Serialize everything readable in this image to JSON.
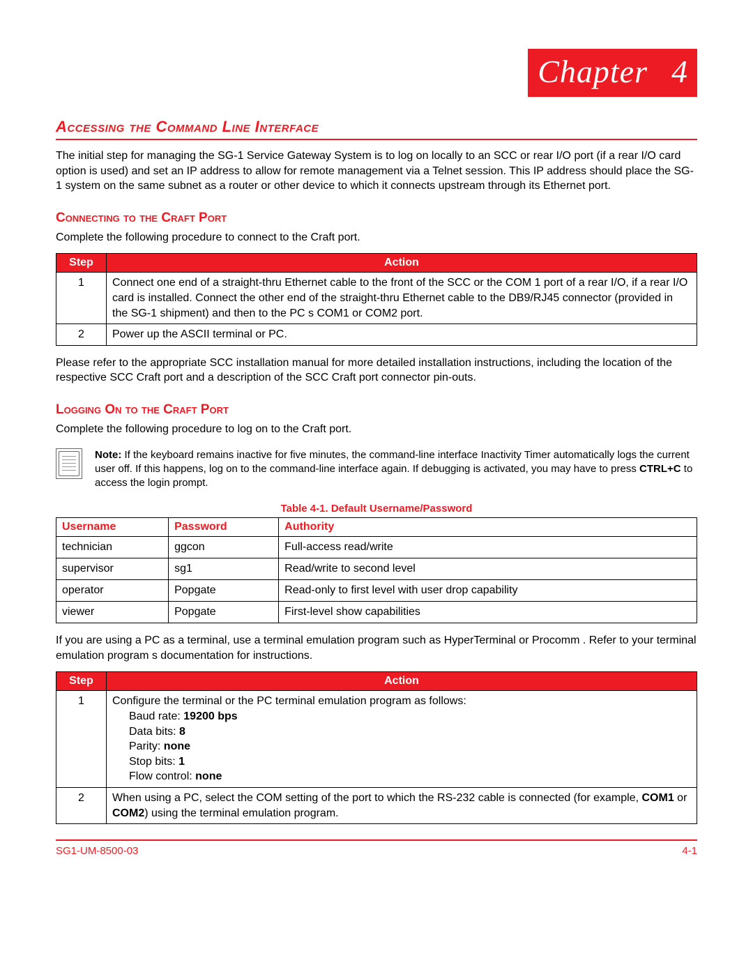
{
  "chapter": {
    "word": "Chapter",
    "num": "4"
  },
  "title": "Accessing the Command Line Interface",
  "intro": "The initial step for managing the SG-1 Service Gateway System is to log on locally to an SCC or rear I/O port (if a rear I/O card option is used) and set an IP address to allow for remote management via a Telnet session. This IP address should place the SG-1 system on the same subnet as a router or other device to which it connects upstream through its Ethernet port.",
  "section1": {
    "heading": "Connecting to the Craft Port",
    "lead": "Complete the following procedure to connect to the Craft port.",
    "cols": {
      "step": "Step",
      "action": "Action"
    },
    "rows": [
      {
        "n": "1",
        "a": "Connect one end of a straight-thru Ethernet cable to the front of the SCC or the COM 1 port of a rear I/O, if a rear I/O card is installed. Connect the other end of the straight-thru Ethernet cable to the DB9/RJ45 connector (provided in the SG-1 shipment) and then to the PC s COM1 or COM2 port."
      },
      {
        "n": "2",
        "a": "Power up the ASCII terminal or PC."
      }
    ],
    "after": "Please refer to the appropriate SCC installation manual for more detailed installation instructions, including the location of the respective SCC Craft port and a description of the SCC Craft port connector pin-outs."
  },
  "section2": {
    "heading": "Logging On to the Craft Port",
    "lead": "Complete the following procedure to log on to the Craft port.",
    "note": {
      "label": "Note:",
      "t1": " If the keyboard remains inactive for five minutes, the command-line interface Inactivity Timer automatically logs the current user off. If this happens, log on to the command-line interface again. If debugging is activated, you may have to press ",
      "bold": "CTRL+C",
      "t2": " to access the login prompt."
    },
    "cred_caption": "Table 4-1. Default Username/Password",
    "cred_cols": {
      "u": "Username",
      "p": "Password",
      "a": "Authority"
    },
    "cred_rows": [
      {
        "u": "technician",
        "p": "ggcon",
        "a": "Full-access read/write"
      },
      {
        "u": "supervisor",
        "p": "sg1",
        "a": "Read/write to second level"
      },
      {
        "u": "operator",
        "p": "Popgate",
        "a": "Read-only to first level with user drop capability"
      },
      {
        "u": "viewer",
        "p": "Popgate",
        "a": "First-level show capabilities"
      }
    ],
    "after_cred": "If you are using a PC as a terminal, use a terminal emulation program such as HyperTerminal or Procomm . Refer to your terminal emulation program s documentation for instructions.",
    "cols": {
      "step": "Step",
      "action": "Action"
    },
    "row1": {
      "n": "1",
      "line": "Configure the terminal or the PC terminal emulation program as follows:",
      "baud_l": "Baud rate: ",
      "baud_v": "19200 bps",
      "data_l": "Data bits: ",
      "data_v": "8",
      "par_l": "Parity: ",
      "par_v": "none",
      "stop_l": "Stop bits: ",
      "stop_v": "1",
      "flow_l": "Flow control: ",
      "flow_v": "none"
    },
    "row2": {
      "n": "2",
      "t1": "When using a PC, select the COM setting of the port to which the RS-232 cable is connected (for example, ",
      "b1": "COM1",
      "t2": " or ",
      "b2": "COM2",
      "t3": ") using the terminal emulation program."
    }
  },
  "footer": {
    "left": "SG1-UM-8500-03",
    "right": "4-1"
  }
}
